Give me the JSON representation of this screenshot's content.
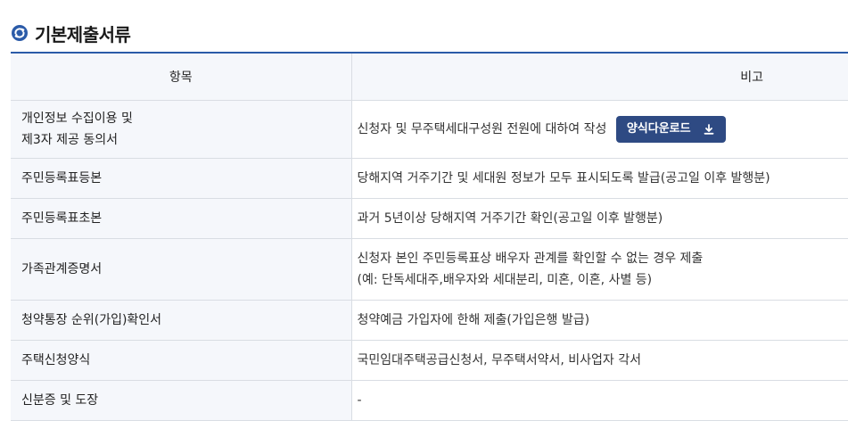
{
  "section": {
    "title": "기본제출서류",
    "icon": "refresh-icon",
    "icon_color": "#2b5ba8"
  },
  "table": {
    "headers": [
      "항목",
      "비고"
    ],
    "rows": [
      {
        "item_lines": [
          "개인정보 수집이용 및",
          "제3자 제공 동의서"
        ],
        "note_lines": [
          "신청자 및 무주택세대구성원 전원에 대하여 작성"
        ],
        "button": {
          "label": "양식다운로드",
          "icon": "download-icon",
          "color": "#2e4a83"
        }
      },
      {
        "item_lines": [
          "주민등록표등본"
        ],
        "note_lines": [
          "당해지역 거주기간 및 세대원 정보가 모두 표시되도록 발급(공고일 이후 발행분)"
        ]
      },
      {
        "item_lines": [
          "주민등록표초본"
        ],
        "note_lines": [
          "과거 5년이상 당해지역 거주기간 확인(공고일 이후 발행분)"
        ]
      },
      {
        "item_lines": [
          "가족관계증명서"
        ],
        "note_lines": [
          "신청자 본인 주민등록표상 배우자 관계를 확인할 수 없는 경우 제출",
          "(예: 단독세대주,배우자와 세대분리, 미혼, 이혼, 사별 등)"
        ]
      },
      {
        "item_lines": [
          "청약통장 순위(가입)확인서"
        ],
        "note_lines": [
          "청약예금 가입자에 한해 제출(가입은행 발급)"
        ]
      },
      {
        "item_lines": [
          "주택신청양식"
        ],
        "note_lines": [
          "국민임대주택공급신청서, 무주택서약서, 비사업자 각서"
        ]
      },
      {
        "item_lines": [
          "신분증 및 도장"
        ],
        "note_lines": [
          "-"
        ]
      }
    ]
  }
}
